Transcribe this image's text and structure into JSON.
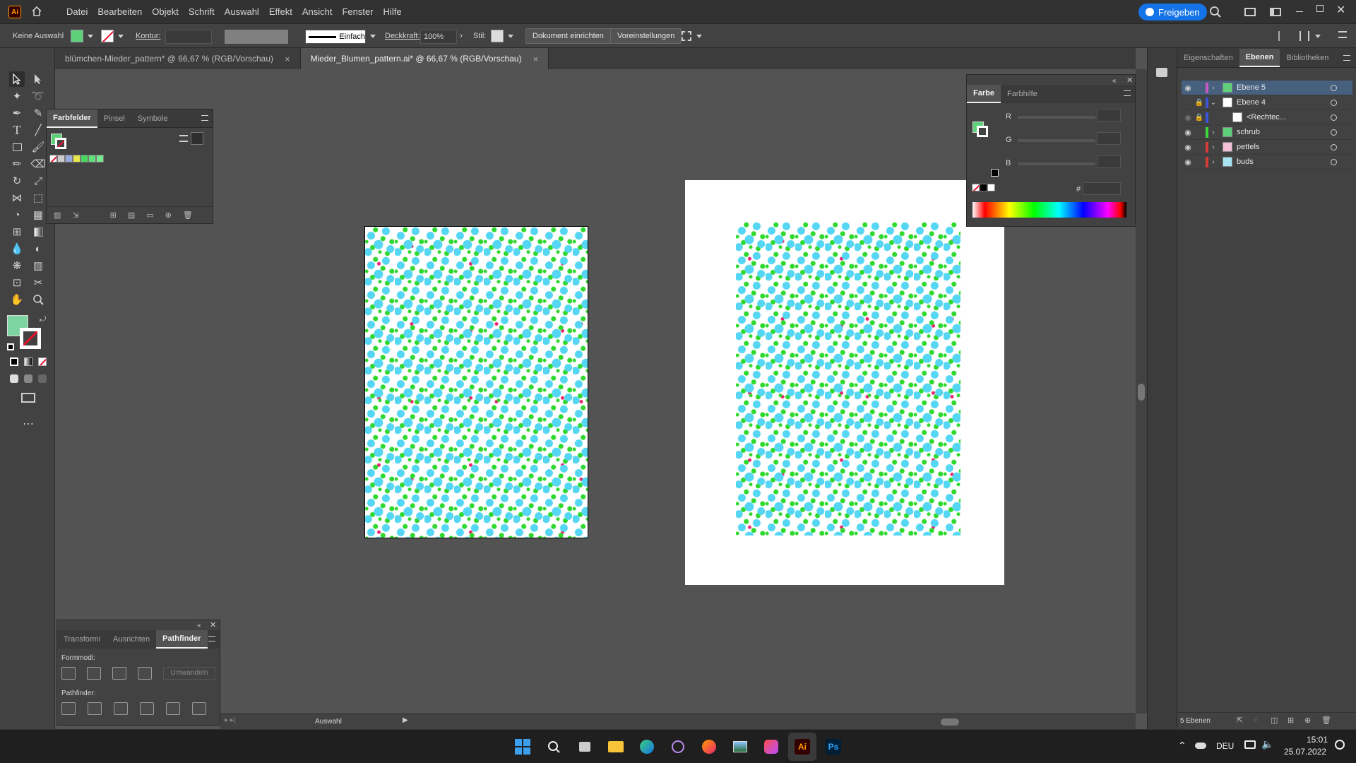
{
  "app": {
    "logo": "Ai",
    "home_icon": "home-icon"
  },
  "menu": [
    "Datei",
    "Bearbeiten",
    "Objekt",
    "Schrift",
    "Auswahl",
    "Effekt",
    "Ansicht",
    "Fenster",
    "Hilfe"
  ],
  "share_label": "Freigeben",
  "control": {
    "selection": "Keine Auswahl",
    "stroke_label": "Kontur:",
    "stroke_style": "Einfach",
    "opacity_label": "Deckkraft:",
    "opacity_value": "100%",
    "style_label": "Stil:",
    "doc_setup": "Dokument einrichten",
    "preferences": "Voreinstellungen"
  },
  "tabs": [
    {
      "label": "blümchen-Mieder_pattern* @ 66,67 % (RGB/Vorschau)",
      "close": "×"
    },
    {
      "label": "Mieder_Blumen_pattern.ai* @ 66,67 % (RGB/Vorschau)",
      "close": "×"
    }
  ],
  "swatches_panel": {
    "tabs": [
      "Farbfelder",
      "Pinsel",
      "Symbole"
    ]
  },
  "color_panel": {
    "tabs": [
      "Farbe",
      "Farbhilfe"
    ],
    "r": "R",
    "g": "G",
    "b": "B",
    "hex_label": "#"
  },
  "pathfinder_panel": {
    "tabs": [
      "Transformi",
      "Ausrichten",
      "Pathfinder"
    ],
    "shape_modes": "Formmodi:",
    "expand": "Umwandeln",
    "pathfinders": "Pathfinder:"
  },
  "right_panel": {
    "tabs": [
      "Eigenschaften",
      "Ebenen",
      "Bibliotheken"
    ],
    "layers": [
      {
        "name": "Ebene 5",
        "color": "#c85ac8"
      },
      {
        "name": "Ebene 4",
        "color": "#3c55d8"
      },
      {
        "name": "<Rechtec...",
        "color": "#3c55d8"
      },
      {
        "name": "schrub",
        "color": "#3ad83a"
      },
      {
        "name": "pettels",
        "color": "#d83a3a"
      },
      {
        "name": "buds",
        "color": "#d83a3a"
      }
    ],
    "layer_count": "5 Ebenen"
  },
  "status": {
    "selection_label": "Auswahl"
  },
  "taskbar": {
    "lang": "DEU",
    "time": "15:01",
    "date": "25.07.2022"
  },
  "colors": {
    "accent": "#1473e6",
    "ai_brand": "#ff9a00",
    "ai_bg": "#330000",
    "selected_layer": "#46607e"
  }
}
